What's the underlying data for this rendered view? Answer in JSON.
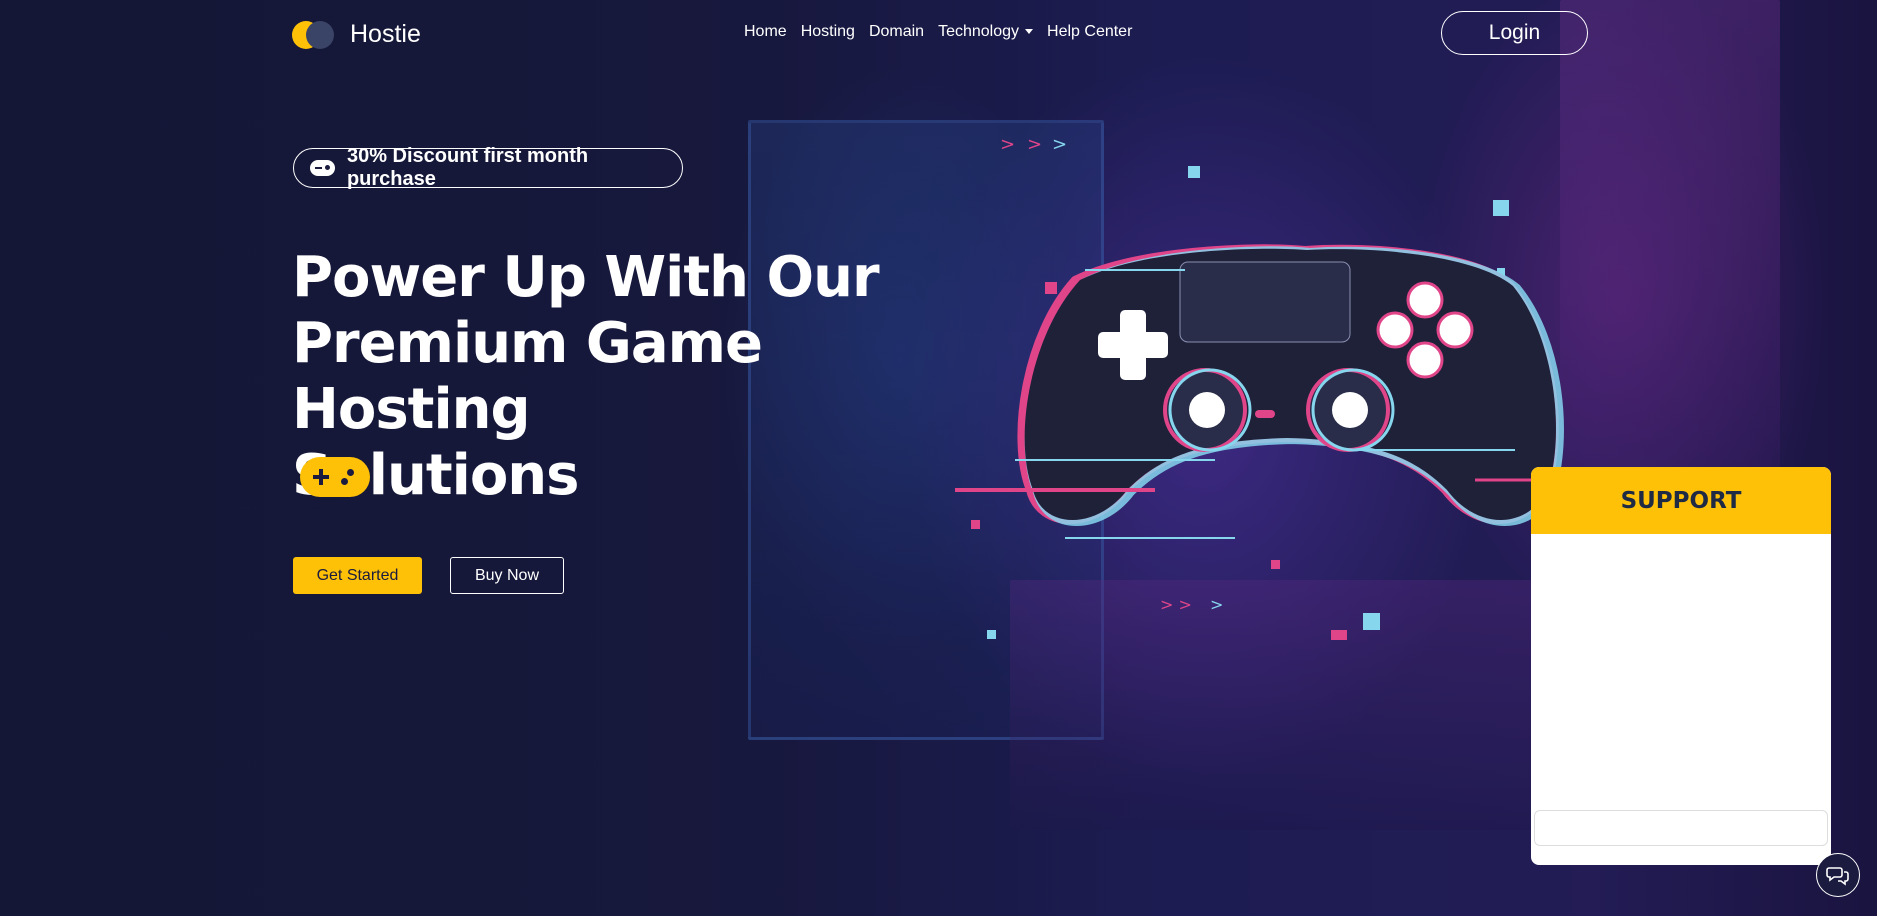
{
  "brand": {
    "name": "Hostie",
    "icon": "logo-circles-icon"
  },
  "nav": {
    "items": [
      {
        "label": "Home"
      },
      {
        "label": "Hosting"
      },
      {
        "label": "Domain"
      },
      {
        "label": "Technology",
        "dropdown": true
      },
      {
        "label": "Help Center"
      }
    ],
    "login_label": "Login"
  },
  "hero": {
    "promo": {
      "icon": "gamepad-icon",
      "text": "30% Discount first month purchase"
    },
    "title_lines": [
      "Power Up With Our",
      "Premium Game Hosting",
      "Solutions"
    ],
    "badge_icon": "gamepad-icon",
    "primary_cta": "Get Started",
    "secondary_cta": "Buy Now"
  },
  "support": {
    "title": "SUPPORT",
    "input_placeholder": "",
    "chat_icon": "chat-bubbles-icon"
  },
  "colors": {
    "accent": "#ffc107",
    "background": "#17183d",
    "neon_pink": "#e0458a",
    "neon_cyan": "#86d6ee"
  }
}
